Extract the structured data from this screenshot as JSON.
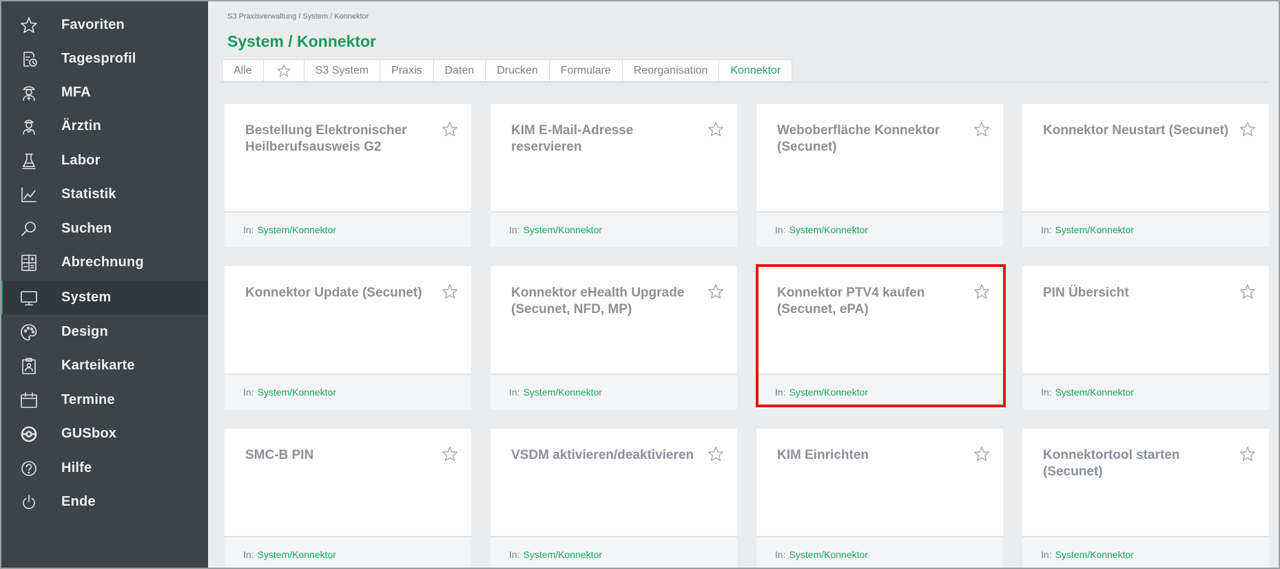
{
  "sidebar": {
    "items": [
      {
        "label": "Favoriten",
        "icon": "star-icon",
        "active": false
      },
      {
        "label": "Tagesprofil",
        "icon": "day-profile-icon",
        "active": false
      },
      {
        "label": "MFA",
        "icon": "mfa-icon",
        "active": false
      },
      {
        "label": "Ärztin",
        "icon": "doctor-icon",
        "active": false
      },
      {
        "label": "Labor",
        "icon": "flask-icon",
        "active": false
      },
      {
        "label": "Statistik",
        "icon": "chart-icon",
        "active": false
      },
      {
        "label": "Suchen",
        "icon": "search-icon",
        "active": false
      },
      {
        "label": "Abrechnung",
        "icon": "calculator-icon",
        "active": false
      },
      {
        "label": "System",
        "icon": "monitor-icon",
        "active": true
      },
      {
        "label": "Design",
        "icon": "palette-icon",
        "active": false
      },
      {
        "label": "Karteikarte",
        "icon": "clipboard-icon",
        "active": false
      },
      {
        "label": "Termine",
        "icon": "calendar-icon",
        "active": false
      },
      {
        "label": "GUSbox",
        "icon": "gusbox-icon",
        "active": false
      },
      {
        "label": "Hilfe",
        "icon": "help-icon",
        "active": false
      },
      {
        "label": "Ende",
        "icon": "power-icon",
        "active": false
      }
    ]
  },
  "header": {
    "breadcrumb": "S3 Praxisverwaltung / System / Konnektor",
    "title": "System / Konnektor"
  },
  "tabs": [
    {
      "label": "Alle",
      "active": false
    },
    {
      "label": "",
      "icon": "star-icon",
      "active": false
    },
    {
      "label": "S3 System",
      "active": false
    },
    {
      "label": "Praxis",
      "active": false
    },
    {
      "label": "Daten",
      "active": false
    },
    {
      "label": "Drucken",
      "active": false
    },
    {
      "label": "Formulare",
      "active": false
    },
    {
      "label": "Reorganisation",
      "active": false
    },
    {
      "label": "Konnektor",
      "active": true
    }
  ],
  "cards": [
    {
      "title": "Bestellung Elektronischer Heilberufsausweis G2",
      "footer_prefix": "In:",
      "footer_link": "System/Konnektor",
      "highlighted": false
    },
    {
      "title": "KIM E-Mail-Adresse reservieren",
      "footer_prefix": "In:",
      "footer_link": "System/Konnektor",
      "highlighted": false
    },
    {
      "title": "Weboberfläche Konnektor (Secunet)",
      "footer_prefix": "In:",
      "footer_link": "System/Konnektor",
      "highlighted": false
    },
    {
      "title": "Konnektor Neustart (Secunet)",
      "footer_prefix": "In:",
      "footer_link": "System/Konnektor",
      "highlighted": false
    },
    {
      "title": "Konnektor Update (Secunet)",
      "footer_prefix": "In:",
      "footer_link": "System/Konnektor",
      "highlighted": false
    },
    {
      "title": "Konnektor eHealth Upgrade (Secunet, NFD, MP)",
      "footer_prefix": "In:",
      "footer_link": "System/Konnektor",
      "highlighted": false
    },
    {
      "title": "Konnektor PTV4 kaufen (Secunet, ePA)",
      "footer_prefix": "In:",
      "footer_link": "System/Konnektor",
      "highlighted": true
    },
    {
      "title": "PIN Übersicht",
      "footer_prefix": "In:",
      "footer_link": "System/Konnektor",
      "highlighted": false
    },
    {
      "title": "SMC-B PIN",
      "footer_prefix": "In:",
      "footer_link": "System/Konnektor",
      "highlighted": false
    },
    {
      "title": "VSDM aktivieren/deaktivieren",
      "footer_prefix": "In:",
      "footer_link": "System/Konnektor",
      "highlighted": false
    },
    {
      "title": "KIM Einrichten",
      "footer_prefix": "In:",
      "footer_link": "System/Konnektor",
      "highlighted": false
    },
    {
      "title": "Konnektortool starten (Secunet)",
      "footer_prefix": "In:",
      "footer_link": "System/Konnektor",
      "highlighted": false
    }
  ],
  "colors": {
    "accent": "#1aa364",
    "sidebar": "#3b434b",
    "highlight": "#ee0e0e"
  }
}
